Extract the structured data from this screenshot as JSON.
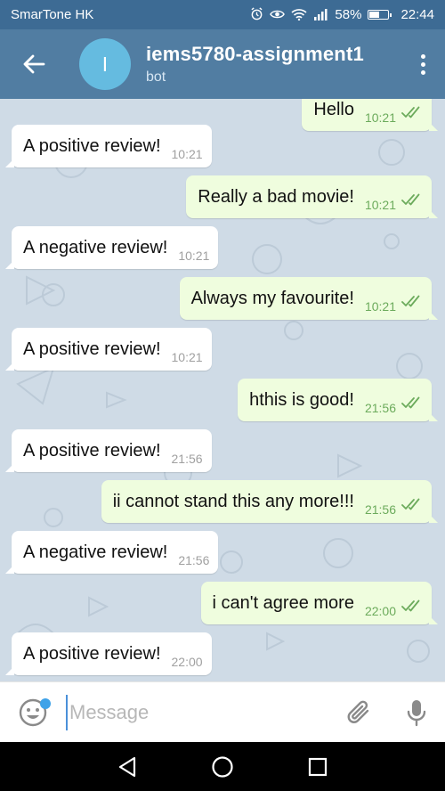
{
  "status_bar": {
    "carrier": "SmarTone HK",
    "battery_text": "58%",
    "battery_level": 0.58,
    "time": "22:44",
    "icons": [
      "alarm-icon",
      "eye-icon",
      "wifi-icon",
      "signal-icon",
      "battery-icon"
    ]
  },
  "header": {
    "avatar_letter": "I",
    "title": "iems5780-assignment1",
    "subtitle": "bot",
    "colors": {
      "bar": "#517da2",
      "avatar": "#65bbe0"
    }
  },
  "messages": [
    {
      "direction": "out",
      "text": "Hello",
      "time": "10:21",
      "read": true,
      "partial": true
    },
    {
      "direction": "in",
      "text": "A positive review!",
      "time": "10:21"
    },
    {
      "direction": "out",
      "text": "Really a bad movie!",
      "time": "10:21",
      "read": true
    },
    {
      "direction": "in",
      "text": "A negative review!",
      "time": "10:21"
    },
    {
      "direction": "out",
      "text": "Always my favourite!",
      "time": "10:21",
      "read": true
    },
    {
      "direction": "in",
      "text": "A positive review!",
      "time": "10:21"
    },
    {
      "direction": "out",
      "text": "hthis is good!",
      "time": "21:56",
      "read": true
    },
    {
      "direction": "in",
      "text": "A positive review!",
      "time": "21:56"
    },
    {
      "direction": "out",
      "text": "ii cannot stand this any more!!!",
      "time": "21:56",
      "read": true
    },
    {
      "direction": "in",
      "text": "A negative review!",
      "time": "21:56"
    },
    {
      "direction": "out",
      "text": "i can't agree more",
      "time": "22:00",
      "read": true
    },
    {
      "direction": "in",
      "text": "A positive review!",
      "time": "22:00"
    }
  ],
  "input": {
    "placeholder": "Message",
    "value": ""
  },
  "icons": {
    "back": "arrow-left-icon",
    "menu": "more-vertical-icon",
    "emoji": "emoji-icon",
    "attach": "paperclip-icon",
    "mic": "microphone-icon",
    "nav_back": "triangle-back-icon",
    "nav_home": "circle-home-icon",
    "nav_recent": "square-recent-icon"
  }
}
